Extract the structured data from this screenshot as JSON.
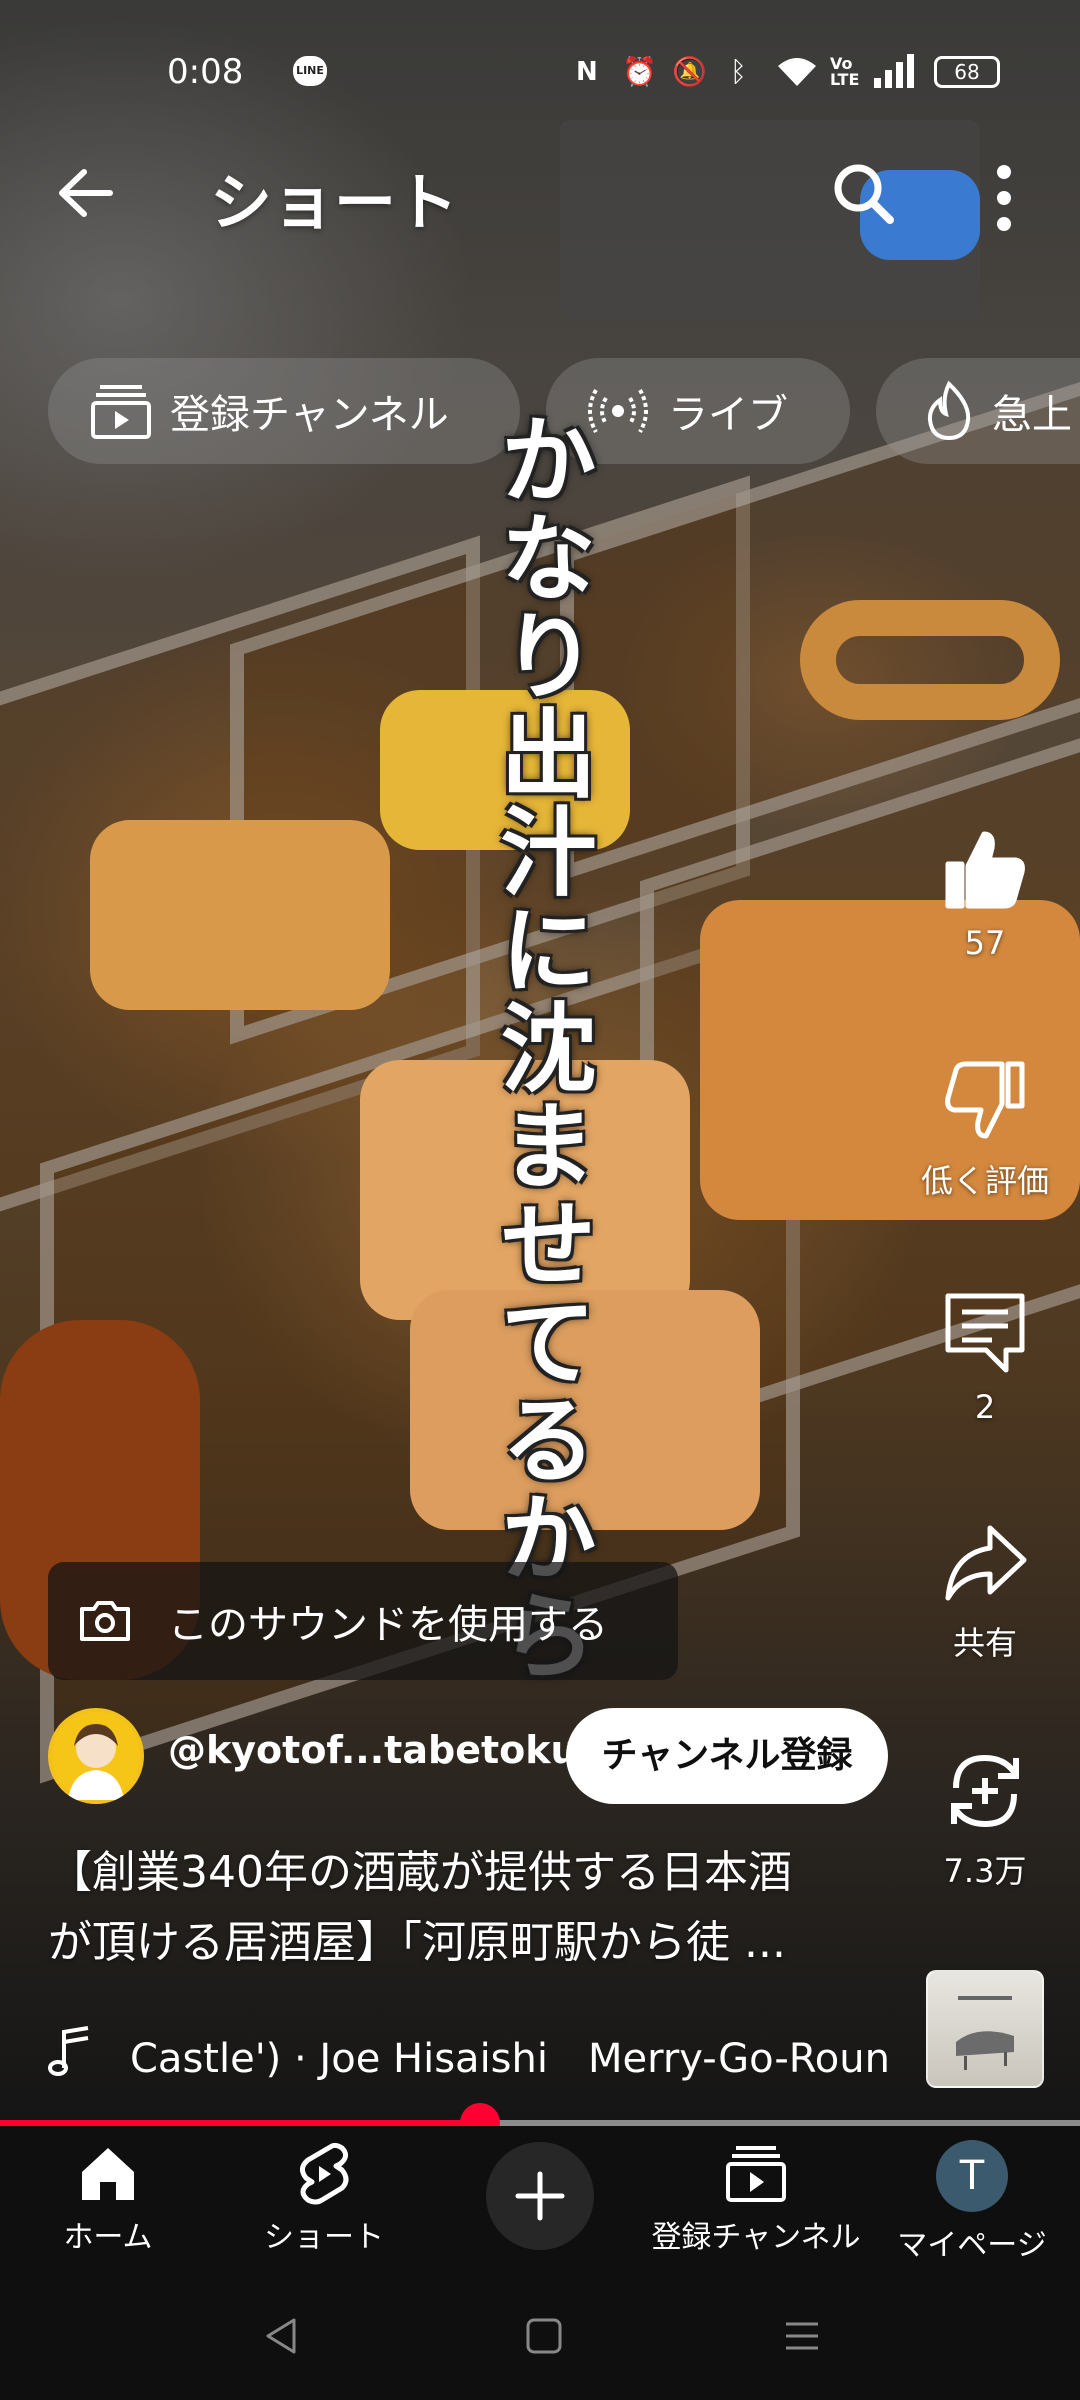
{
  "status_bar": {
    "time": "0:08",
    "line_badge": "LINE",
    "battery": "68"
  },
  "header": {
    "title": "ショート",
    "icons": [
      "back-arrow-icon",
      "search-icon",
      "more-vert-icon"
    ]
  },
  "chips": [
    {
      "label": "登録チャンネル",
      "icon": "subscriptions-icon"
    },
    {
      "label": "ライブ",
      "icon": "live-icon"
    },
    {
      "label": "急上",
      "icon": "trending-icon"
    }
  ],
  "video": {
    "caption": "かなり出汁に沈ませてるから"
  },
  "actions": {
    "like": {
      "label": "57",
      "icon": "thumb-up-icon"
    },
    "dislike": {
      "label": "低く評価",
      "icon": "thumb-down-icon"
    },
    "comment": {
      "label": "2",
      "icon": "comment-icon"
    },
    "share": {
      "label": "共有",
      "icon": "share-icon"
    },
    "remix": {
      "label": "7.3万",
      "icon": "remix-icon"
    }
  },
  "sound": {
    "label": "このサウンドを使用する",
    "icon": "camera-icon"
  },
  "channel": {
    "handle": "@kyotof...tabetoku",
    "subscribe_label": "チャンネル登録"
  },
  "description": {
    "line1": "【創業340年の酒蔵が提供する日本酒",
    "line2": "が頂ける居酒屋】「河原町駅から徒 ..."
  },
  "music": {
    "text": "Castle') · Joe Hisaishi　Merry-Go-Round",
    "icon": "music-note-icon"
  },
  "progress": {
    "fraction": 0.444
  },
  "bottom_nav": {
    "home": "ホーム",
    "shorts": "ショート",
    "subscriptions": "登録チャンネル",
    "mypage": "マイページ",
    "avatar_initial": "T"
  },
  "colors": {
    "accent_red": "#ff0033",
    "nav_bg": "#0f0f0f"
  }
}
